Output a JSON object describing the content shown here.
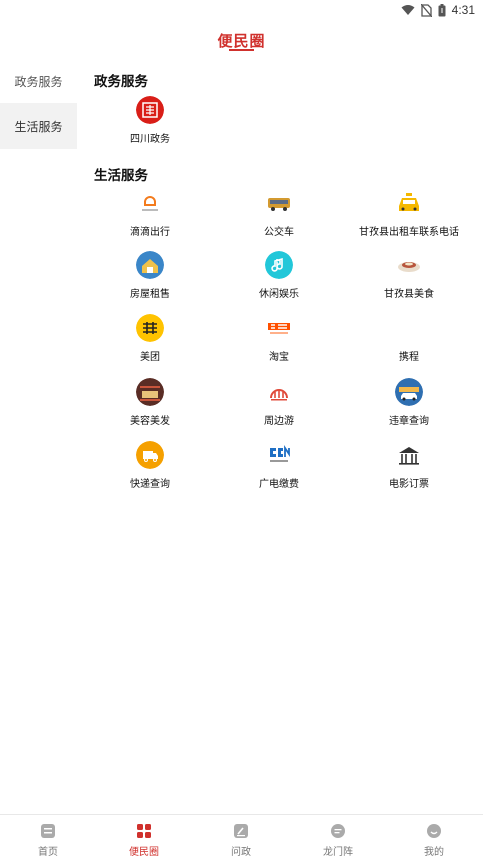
{
  "status": {
    "time": "4:31"
  },
  "header": {
    "title": "便民圈"
  },
  "sidebar": {
    "items": [
      {
        "label": "政务服务"
      },
      {
        "label": "生活服务"
      }
    ]
  },
  "sections": {
    "gov": {
      "title": "政务服务",
      "items": [
        {
          "label": "四川政务",
          "icon": "sichuan-gov-icon"
        }
      ]
    },
    "life": {
      "title": "生活服务",
      "items": [
        {
          "label": "滴滴出行",
          "icon": "didi-icon"
        },
        {
          "label": "公交车",
          "icon": "bus-icon"
        },
        {
          "label": "甘孜县出租车联系电话",
          "icon": "taxi-icon"
        },
        {
          "label": "房屋租售",
          "icon": "house-rental-icon"
        },
        {
          "label": "休闲娱乐",
          "icon": "leisure-icon"
        },
        {
          "label": "甘孜县美食",
          "icon": "food-icon"
        },
        {
          "label": "美团",
          "icon": "meituan-icon"
        },
        {
          "label": "淘宝",
          "icon": "taobao-icon"
        },
        {
          "label": "携程",
          "icon": "ctrip-icon"
        },
        {
          "label": "美容美发",
          "icon": "beauty-icon"
        },
        {
          "label": "周边游",
          "icon": "nearby-travel-icon"
        },
        {
          "label": "违章查询",
          "icon": "violation-query-icon"
        },
        {
          "label": "快递查询",
          "icon": "express-query-icon"
        },
        {
          "label": "广电缴费",
          "icon": "broadcast-payment-icon"
        },
        {
          "label": "电影订票",
          "icon": "movie-ticket-icon"
        }
      ]
    }
  },
  "bottomnav": {
    "items": [
      {
        "label": "首页"
      },
      {
        "label": "便民圈"
      },
      {
        "label": "问政"
      },
      {
        "label": "龙门阵"
      },
      {
        "label": "我的"
      }
    ]
  },
  "colors": {
    "accent": "#d0312d"
  }
}
